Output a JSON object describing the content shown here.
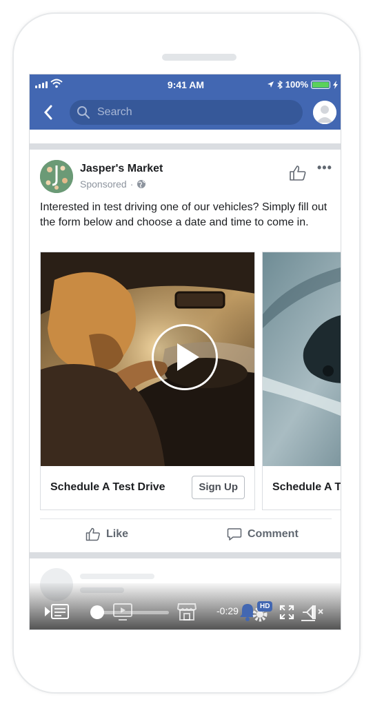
{
  "status_bar": {
    "time": "9:41 AM",
    "battery": "100%",
    "battery_level": 1.0
  },
  "nav": {
    "search_placeholder": "Search"
  },
  "post": {
    "page_name": "Jasper's Market",
    "sponsored_label": "Sponsored",
    "text": "Interested in test driving one of our vehicles? Simply fill out the form below and choose a date and time to come in.",
    "cards": [
      {
        "title": "Schedule A Test Drive",
        "cta": "Sign Up"
      },
      {
        "title": "Schedule A T"
      }
    ],
    "actions": {
      "like": "Like",
      "comment": "Comment"
    }
  },
  "video_controls": {
    "remaining": "-0:29",
    "quality_badge": "HD",
    "progress": 0.05
  },
  "colors": {
    "brand": "#4267b2",
    "search_bg": "#365899",
    "battery": "#5bd15b"
  }
}
